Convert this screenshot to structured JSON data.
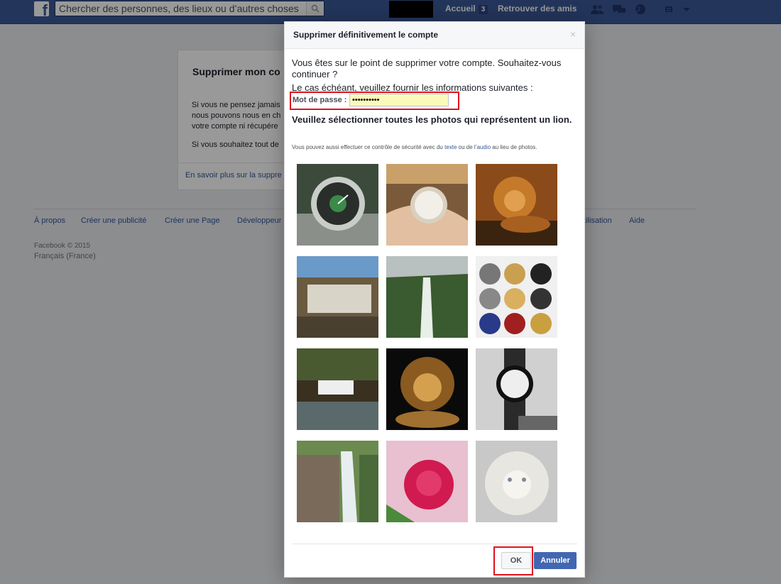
{
  "topbar": {
    "logo_letter": "f",
    "search_placeholder": "Chercher des personnes, des lieux ou d’autres choses",
    "home_label": "Accueil",
    "home_badge": "3",
    "find_friends_label": "Retrouver des amis"
  },
  "background_page": {
    "card_title": "Supprimer mon co",
    "card_text_lines": [
      "Si vous ne pensez jamais",
      "nous pouvons nous en ch",
      "votre compte ni récupére"
    ],
    "card_text_2": "Si vous souhaitez tout de",
    "card_link": "En savoir plus sur la suppre",
    "footer_links": [
      "À propos",
      "Créer une publicité",
      "Créer une Page",
      "Développeur",
      "tilisation",
      "Aide"
    ],
    "copyright": "Facebook © 2015",
    "language": "Français (France)"
  },
  "dialog": {
    "title": "Supprimer définitivement le compte",
    "close": "×",
    "intro": "Vous êtes sur le point de supprimer votre compte. Souhaitez-vous continuer ?",
    "intro2": "Le cas échéant, veuillez fournir les informations suivantes :",
    "password_label": "Mot de passe :",
    "password_value": "••••••••••",
    "captcha_question": "Veuillez sélectionner toutes les photos qui représentent un lion.",
    "captcha_note_prefix": "Vous pouvez aussi effectuer ce contrôle de sécurité avec du ",
    "captcha_note_text_link": "texte",
    "captcha_note_middle": " ou de l’",
    "captcha_note_audio_link": "audio",
    "captcha_note_suffix": " au lieu de photos.",
    "ok_label": "OK",
    "cancel_label": "Annuler"
  },
  "photos": [
    {
      "subject": "watch"
    },
    {
      "subject": "watch-on-wrist"
    },
    {
      "subject": "lion"
    },
    {
      "subject": "waterfall"
    },
    {
      "subject": "waterfall"
    },
    {
      "subject": "watches-collage"
    },
    {
      "subject": "waterfall"
    },
    {
      "subject": "lion"
    },
    {
      "subject": "watch"
    },
    {
      "subject": "waterfall"
    },
    {
      "subject": "rose"
    },
    {
      "subject": "white-lion"
    }
  ],
  "colors": {
    "topbar": "#3b5998",
    "highlight": "#e0121e",
    "primary_button": "#4267b2"
  }
}
